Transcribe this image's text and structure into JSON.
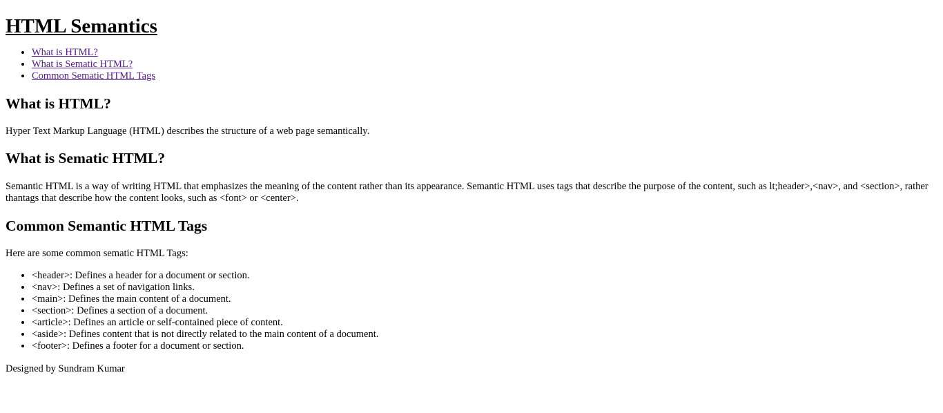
{
  "title": "HTML Semantics",
  "toc": [
    {
      "label": "What is HTML?"
    },
    {
      "label": "What is Sematic HTML?"
    },
    {
      "label": "Common Sematic HTML Tags"
    }
  ],
  "sections": {
    "what_is_html": {
      "heading": "What is HTML?",
      "text": "Hyper Text Markup Language (HTML) describes the structure of a web page semantically."
    },
    "semantic_html": {
      "heading": "What is Sematic HTML?",
      "text": "Semantic HTML is a way of writing HTML that emphasizes the meaning of the content rather than its appearance. Semantic HTML uses tags that describe the purpose of the content, such as lt;header>,<nav>, and <section>, rather thantags that describe how the content looks, such as <font> or <center>."
    },
    "common_tags": {
      "heading": "Common Semantic HTML Tags",
      "intro": "Here are some common sematic HTML Tags:",
      "items": [
        "<header>: Defines a header for a document or section.",
        "<nav>: Defines a set of navigation links.",
        "<main>: Defines the main content of a document.",
        "<section>: Defines a section of a document.",
        "<article>: Defines an article or self-contained piece of content.",
        "<aside>: Defines content that is not directly related to the main content of a document.",
        "<footer>: Defines a footer for a document or section."
      ]
    }
  },
  "footer": {
    "credit": "Designed by Sundram Kumar"
  },
  "colors": {
    "visited_link": "#551a8b",
    "text": "#000000",
    "background": "#ffffff"
  }
}
